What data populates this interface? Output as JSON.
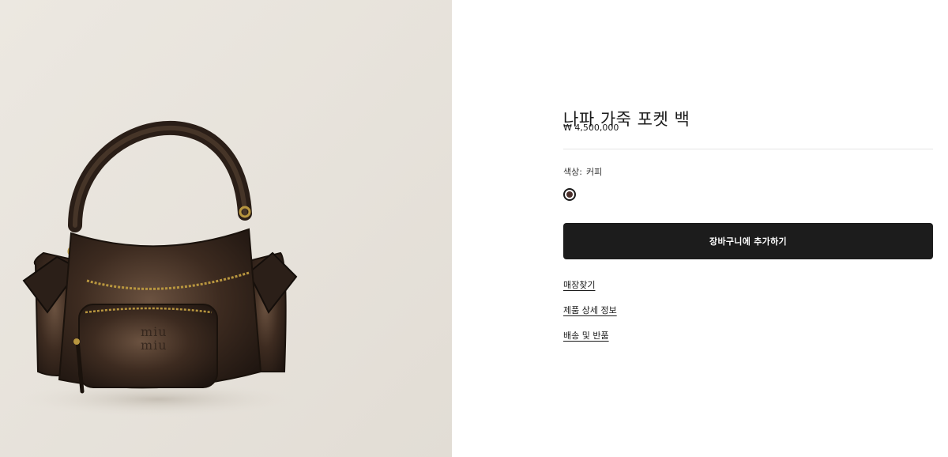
{
  "product": {
    "image_alt": "Miu Miu leather pocket bag",
    "logo_text": "miu miu",
    "title": "나파 가죽 포켓 백",
    "price": "₩ 4,500,000",
    "color_label": "색상:",
    "color_value": "커피",
    "swatch_color": "#4a2f2a"
  },
  "actions": {
    "add_to_cart": "장바구니에 추가하기"
  },
  "links": {
    "find_store": "매장찾기",
    "product_details": "제품 상세 정보",
    "shipping_returns": "배송 및 반품"
  }
}
